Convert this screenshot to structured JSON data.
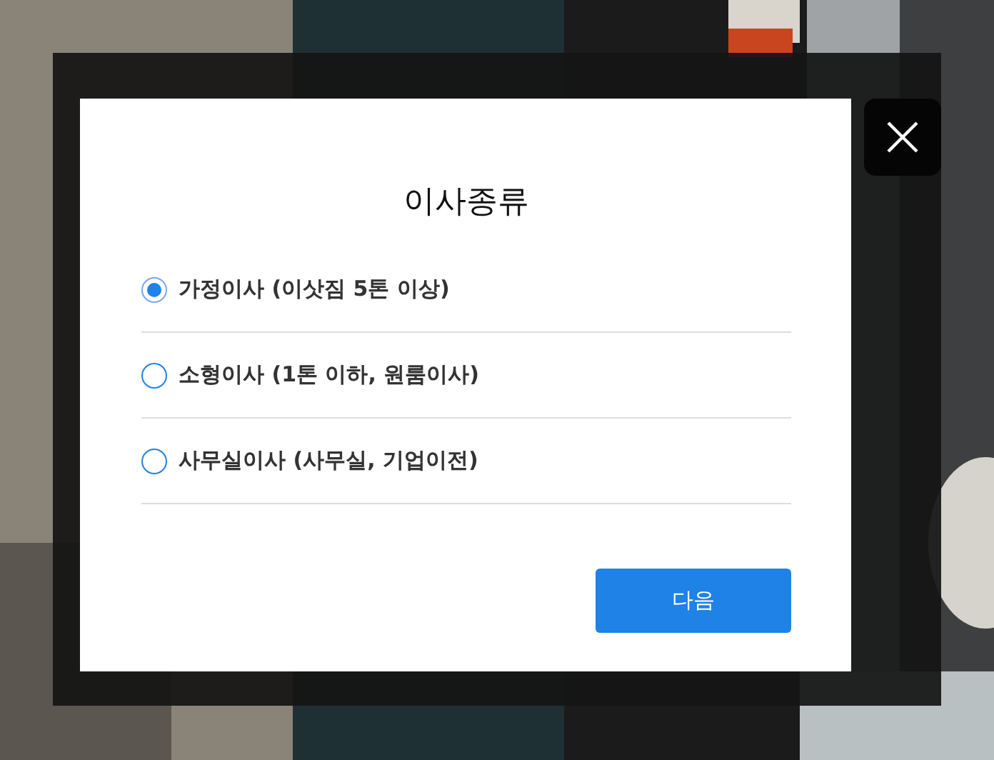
{
  "dialog": {
    "title": "이사종류",
    "options": [
      {
        "label": "가정이사 (이삿짐 5톤 이상)",
        "selected": true
      },
      {
        "label": "소형이사 (1톤 이하, 원룸이사)",
        "selected": false
      },
      {
        "label": "사무실이사 (사무실, 기업이전)",
        "selected": false
      }
    ],
    "next_button": "다음"
  }
}
